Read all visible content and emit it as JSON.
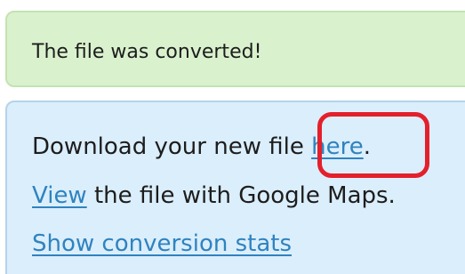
{
  "success_alert": {
    "message": "The file was converted!"
  },
  "info_panel": {
    "download_prefix": "Download your new file ",
    "download_link": "here",
    "download_suffix": ".",
    "view_link": "View",
    "view_suffix": " the file with Google Maps.",
    "stats_link": "Show conversion stats"
  },
  "colors": {
    "success_background": "#d9f2cd",
    "info_background": "#dbeefc",
    "link": "#2f83bf",
    "highlight": "#e3202c"
  }
}
